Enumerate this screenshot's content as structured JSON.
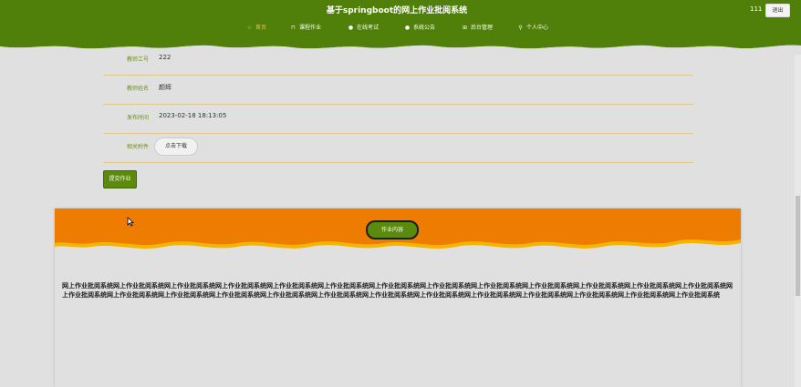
{
  "header": {
    "site_title": "基于springboot的网上作业批阅系统",
    "user": "111",
    "logout_label": "退出",
    "colors": {
      "green": "#507f0a",
      "wave": "#e1e0e1"
    }
  },
  "nav": [
    {
      "label": "首页",
      "icon": "star-icon",
      "glyph": "☆",
      "active": true
    },
    {
      "label": "课程作业",
      "icon": "bag-icon",
      "glyph": "⊓",
      "active": false
    },
    {
      "label": "在线考试",
      "icon": "info-circle-icon",
      "glyph": "●",
      "active": false
    },
    {
      "label": "系统公告",
      "icon": "info-circle-icon",
      "glyph": "●",
      "active": false
    },
    {
      "label": "后台管理",
      "icon": "gift-icon",
      "glyph": "⊞",
      "active": false
    },
    {
      "label": "个人中心",
      "icon": "user-icon",
      "glyph": "⚲",
      "active": false
    }
  ],
  "details": {
    "teacher_id_label": "教师工号",
    "teacher_id": "222",
    "teacher_name_label": "教师姓名",
    "teacher_name": "颜辉",
    "publish_time_label": "发布时间",
    "publish_time": "2023-02-18 18:13:05",
    "attachment_label": "相关附件",
    "download_label": "点击下载"
  },
  "submit_label": "提交作业",
  "content_panel": {
    "tab_label": "作业内容",
    "text": "网上作业批阅系统网上作业批阅系统网上作业批阅系统网上作业批阅系统网上作业批阅系统网上作业批阅系统网上作业批阅系统网上作业批阅系统网上作业批阅系统网上作业批阅系统网上作业批阅系统网上作业批阅系统网上作业批阅系统网上作业批阅系统网上作业批阅系统网上作业批阅系统网上作业批阅系统网上作业批阅系统网上作业批阅系统网上作业批阅系统网上作业批阅系统网上作业批阅系统网上作业批阅系统网上作业批阅系统网上作业批阅系统网上作业批阅系统",
    "colors": {
      "orange": "#ee7c00",
      "yellow": "#f5b400"
    }
  }
}
